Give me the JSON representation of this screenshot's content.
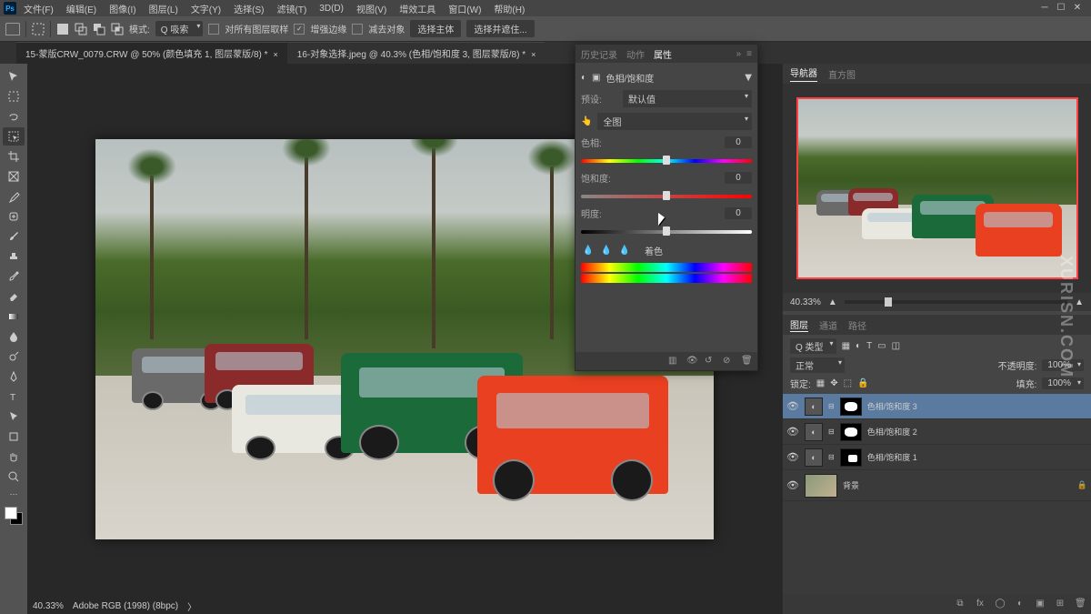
{
  "menu": {
    "items": [
      "文件(F)",
      "编辑(E)",
      "图像(I)",
      "图层(L)",
      "文字(Y)",
      "选择(S)",
      "滤镜(T)",
      "3D(D)",
      "视图(V)",
      "增效工具",
      "窗口(W)",
      "帮助(H)"
    ]
  },
  "optbar": {
    "mode_label": "模式:",
    "mode_value": "Q 吸索",
    "opt1": "对所有图层取样",
    "opt2": "增强边缘",
    "opt3": "减去对象",
    "btn1": "选择主体",
    "btn2": "选择并遮住..."
  },
  "tabs": [
    {
      "title": "15-蒙版CRW_0079.CRW @ 50% (颜色填充 1, 图层蒙版/8) *"
    },
    {
      "title": "16-对象选择.jpeg @ 40.3% (色相/饱和度 3, 图层蒙版/8) *"
    }
  ],
  "status": {
    "zoom": "40.33%",
    "info": "Adobe RGB (1998) (8bpc)"
  },
  "properties": {
    "tabs": {
      "history": "历史记录",
      "actions": "动作",
      "properties": "属性"
    },
    "title": "色相/饱和度",
    "preset_label": "预设:",
    "preset_value": "默认值",
    "range_value": "全图",
    "hue_label": "色相:",
    "hue_value": "0",
    "sat_label": "饱和度:",
    "sat_value": "0",
    "lig_label": "明度:",
    "lig_value": "0",
    "colorize": "着色"
  },
  "navigator": {
    "tabs": {
      "nav": "导航器",
      "histo": "直方图"
    },
    "zoom": "40.33%"
  },
  "layers": {
    "tabs": {
      "layers": "图层",
      "channels": "通道",
      "paths": "路径"
    },
    "filter": "Q 类型",
    "blend": "正常",
    "opacity_label": "不透明度:",
    "opacity": "100%",
    "lock_label": "锁定:",
    "fill_label": "填充:",
    "fill": "100%",
    "items": [
      {
        "name": "色相/饱和度 3"
      },
      {
        "name": "色相/饱和度 2"
      },
      {
        "name": "色相/饱和度 1"
      },
      {
        "name": "背景"
      }
    ]
  },
  "watermark": "XURISN.COM"
}
